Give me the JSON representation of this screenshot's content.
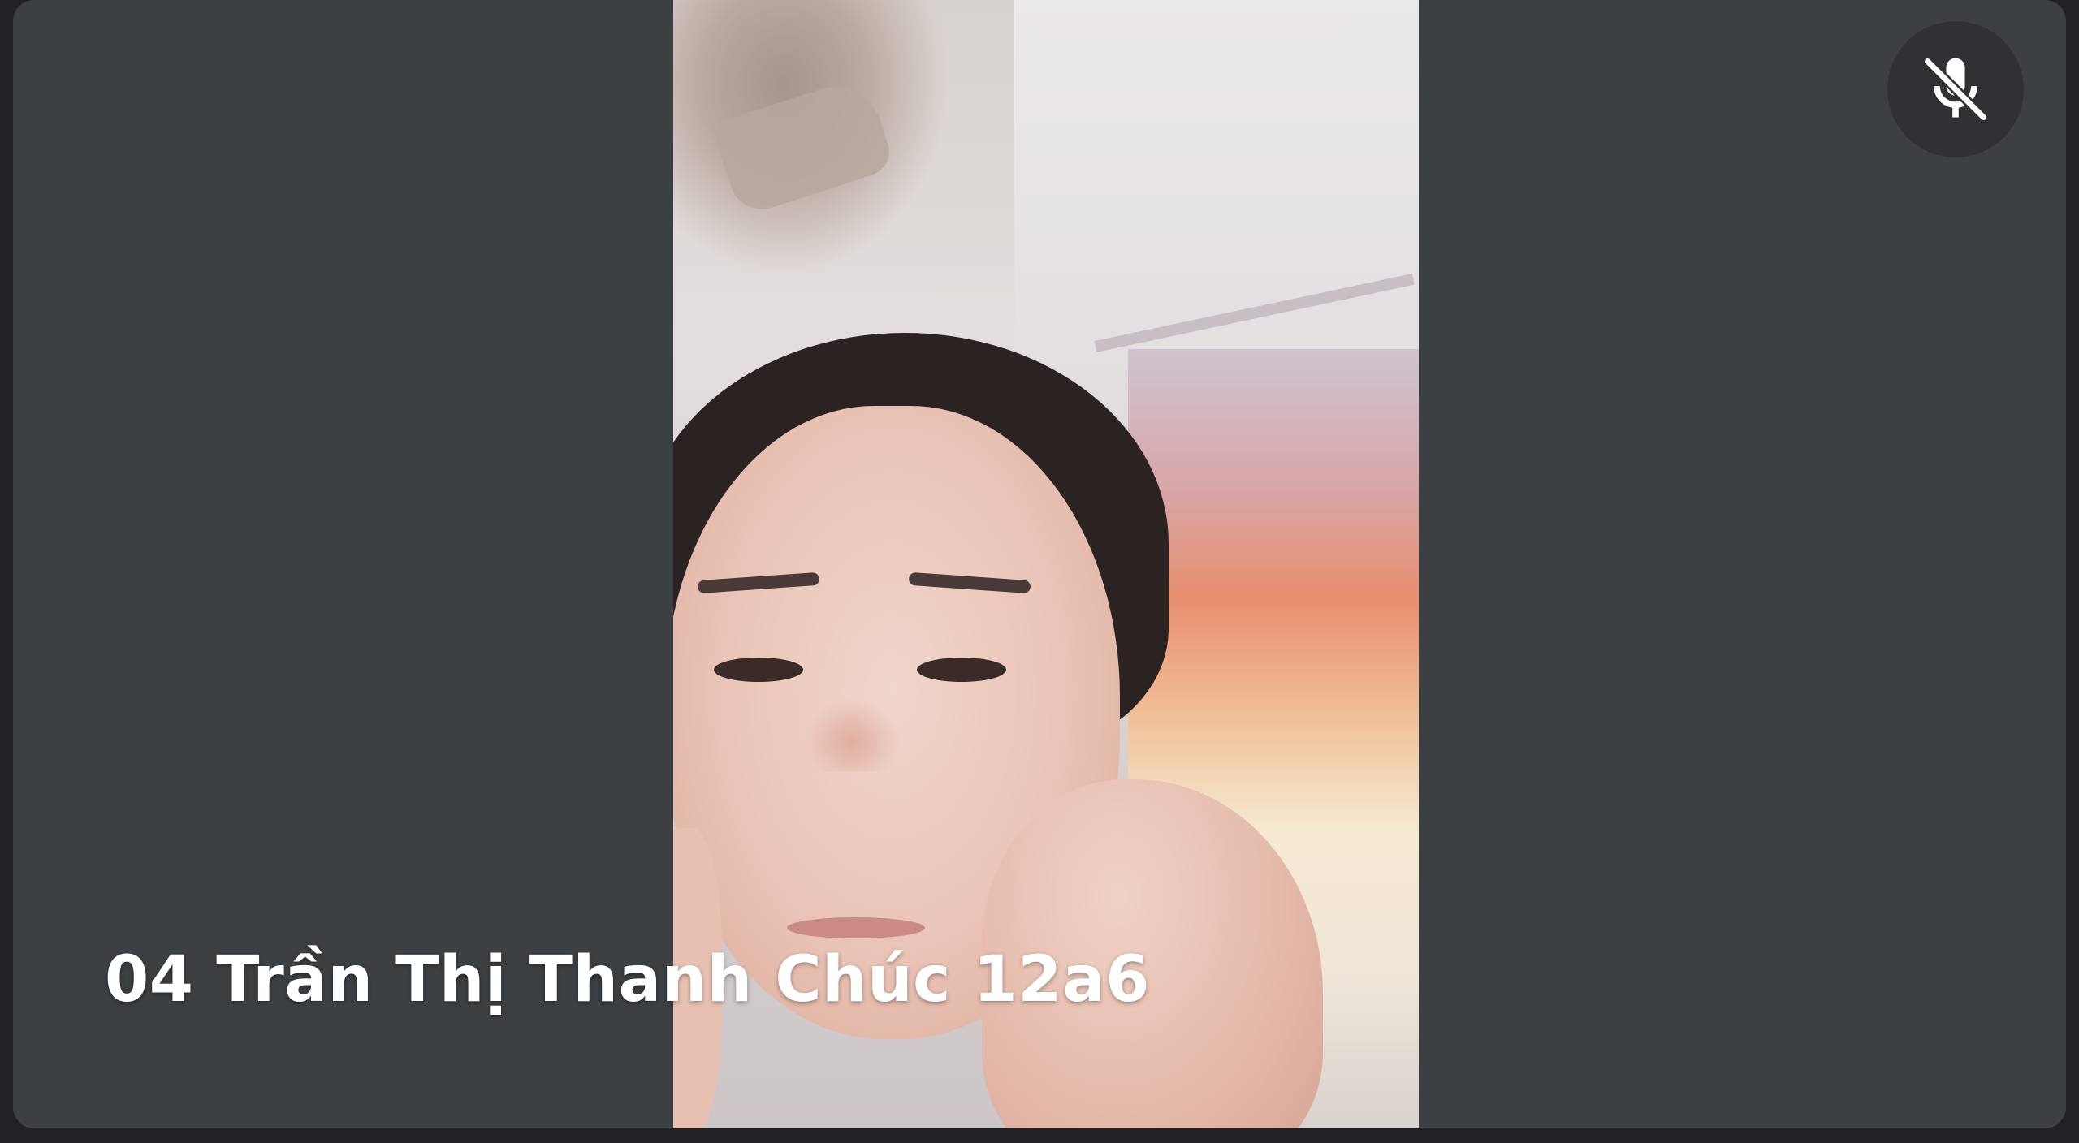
{
  "participant": {
    "name": "04 Trần Thị Thanh Chúc 12a6",
    "mic_status_icon": "mic-off-icon"
  },
  "colors": {
    "tile_background": "#3c4043",
    "page_background": "#202124",
    "name_text": "#ffffff"
  }
}
